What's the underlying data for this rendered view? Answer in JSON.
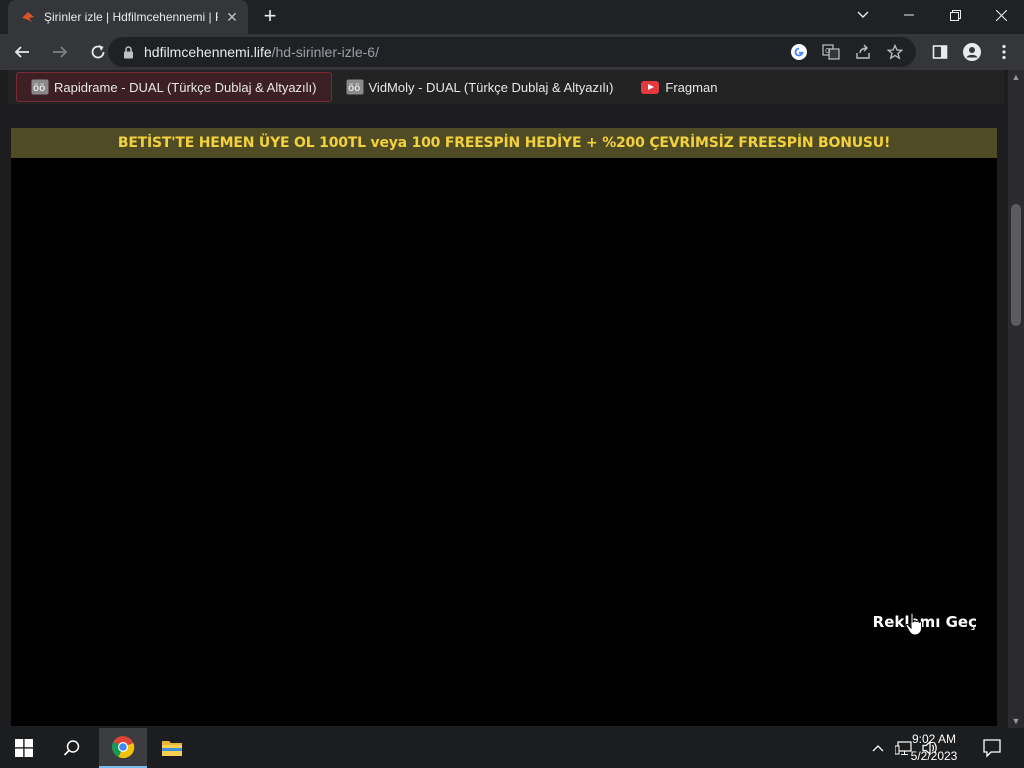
{
  "browser": {
    "tab_title": "Şirinler izle | Hdfilmcehennemi | F",
    "tab_close": "✕",
    "new_tab": "+",
    "url_domain": "hdfilmcehennemi.life",
    "url_path": "/hd-sirinler-izle-6/"
  },
  "page": {
    "sources": [
      {
        "label": "Rapidrame - DUAL (Türkçe Dublaj & Altyazılı)",
        "active": true
      },
      {
        "label": "VidMoly - DUAL (Türkçe Dublaj & Altyazılı)",
        "active": false
      },
      {
        "label": "Fragman",
        "active": false
      }
    ],
    "banner": "BETİST'TE HEMEN ÜYE OL 100TL veya 100 FREESPİN HEDİYE + %200 ÇEVRİMSİZ FREESPİN BONUSU!",
    "skip_ad": "Reklamı Geç"
  },
  "taskbar": {
    "time": "9:02 AM",
    "date": "5/2/2023"
  },
  "colors": {
    "banner_bg": "#4f4b24",
    "banner_text": "#f3d13c",
    "active_source_bg": "#3d2026"
  }
}
